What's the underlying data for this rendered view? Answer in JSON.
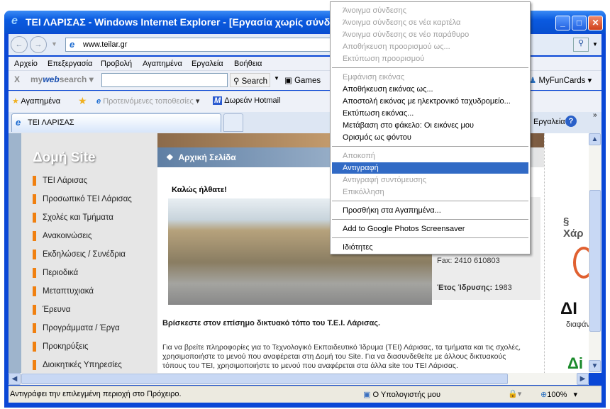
{
  "window": {
    "title": "ΤΕΙ ΛΑΡΙΣΑΣ - Windows Internet Explorer - [Εργασία χωρίς σύνδεση]"
  },
  "address": {
    "url": "www.teilar.gr"
  },
  "menubar": [
    "Αρχείο",
    "Επεξεργασία",
    "Προβολή",
    "Αγαπημένα",
    "Εργαλεία",
    "Βοήθεια"
  ],
  "toolbar": {
    "brand_a": "my",
    "brand_b": "web",
    "brand_c": "search",
    "search_label": "Search",
    "games_label": "Games",
    "myfuncards_label": "MyFunCards",
    "tools_label": "Εργαλεία",
    "close_label": "X"
  },
  "favorites": {
    "label": "Αγαπημένα",
    "suggested": "Προτεινόμενες τοποθεσίες",
    "hotmail": "Δωρεάν Hotmail"
  },
  "tab": {
    "label": "ΤΕΙ ΛΑΡΙΣΑΣ"
  },
  "page": {
    "sidebar_title": "Δομή Site",
    "sidebar_items": [
      "ΤΕΙ Λάρισας",
      "Προσωπικό ΤΕΙ Λάρισας",
      "Σχολές και Τμήματα",
      "Ανακοινώσεις",
      "Εκδηλώσεις / Συνέδρια",
      "Περιοδικά",
      "Μεταπτυχιακά",
      "Έρευνα",
      "Προγράμματα / Έργα",
      "Προκηρύξεις",
      "Διοικητικές Υπηρεσίες"
    ],
    "home_title": "Αρχική Σελίδα",
    "welcome": "Καλώς ήλθατε!",
    "fax": "Fax: 2410 610803",
    "founded_label": "Έτος Ίδρυσης:",
    "founded_value": "1983",
    "intro": "Βρίσκεστε στον επίσημο δικτυακό τόπο του Τ.Ε.Ι. Λάρισας.",
    "para": [
      "Για να βρείτε πληροφορίες για το Τεχνολογικό Εκπαιδευτικό Ίδρυμα (ΤΕΙ) Λάρισας, τα τμήματα και τις σχολές,",
      "χρησιμοποιήστε το μενού που αναφέρεται στη Δομή του Site. Για να διασυνδεθείτε με άλλους δικτυακούς",
      "τόπους του ΤΕΙ, χρησιμοποιήστε το μενού που αναφέρεται στα άλλα site του ΤΕΙ Λάρισας."
    ],
    "right_logos": [
      "Χάρ",
      "ΔΙ",
      "διαφάνε"
    ]
  },
  "context_menu": [
    {
      "label": "Άνοιγμα σύνδεσης",
      "state": "disabled"
    },
    {
      "label": "Άνοιγμα σύνδεσης σε νέα καρτέλα",
      "state": "disabled"
    },
    {
      "label": "Άνοιγμα σύνδεσης σε νέο παράθυρο",
      "state": "disabled"
    },
    {
      "label": "Αποθήκευση προορισμού ως...",
      "state": "disabled"
    },
    {
      "label": "Εκτύπωση προορισμού",
      "state": "disabled"
    },
    {
      "label": "Εμφάνιση εικόνας",
      "state": "disabled"
    },
    {
      "label": "Αποθήκευση εικόνας ως...",
      "state": "enabled"
    },
    {
      "label": "Αποστολή εικόνας με ηλεκτρονικό ταχυδρομείο...",
      "state": "enabled"
    },
    {
      "label": "Εκτύπωση εικόνας...",
      "state": "enabled"
    },
    {
      "label": "Μετάβαση στο φάκελο: Οι εικόνες μου",
      "state": "enabled"
    },
    {
      "label": "Ορισμός ως φόντου",
      "state": "enabled"
    },
    {
      "label": "Αποκοπή",
      "state": "disabled"
    },
    {
      "label": "Αντιγραφή",
      "state": "highlighted"
    },
    {
      "label": "Αντιγραφή συντόμευσης",
      "state": "disabled"
    },
    {
      "label": "Επικόλληση",
      "state": "disabled"
    },
    {
      "label": "Προσθήκη στα Αγαπημένα...",
      "state": "enabled"
    },
    {
      "label": "Add to Google Photos Screensaver",
      "state": "enabled"
    },
    {
      "label": "Ιδιότητες",
      "state": "enabled"
    }
  ],
  "status": {
    "text": "Αντιγράφει την επιλεγμένη περιοχή στο Πρόχειρο.",
    "zone": "Ο Υπολογιστής μου",
    "zoom": "100%"
  },
  "colors": {
    "accent": "#316ac5",
    "sidebar_marker": "#f08010",
    "titlebar": "#0a5ae0"
  }
}
